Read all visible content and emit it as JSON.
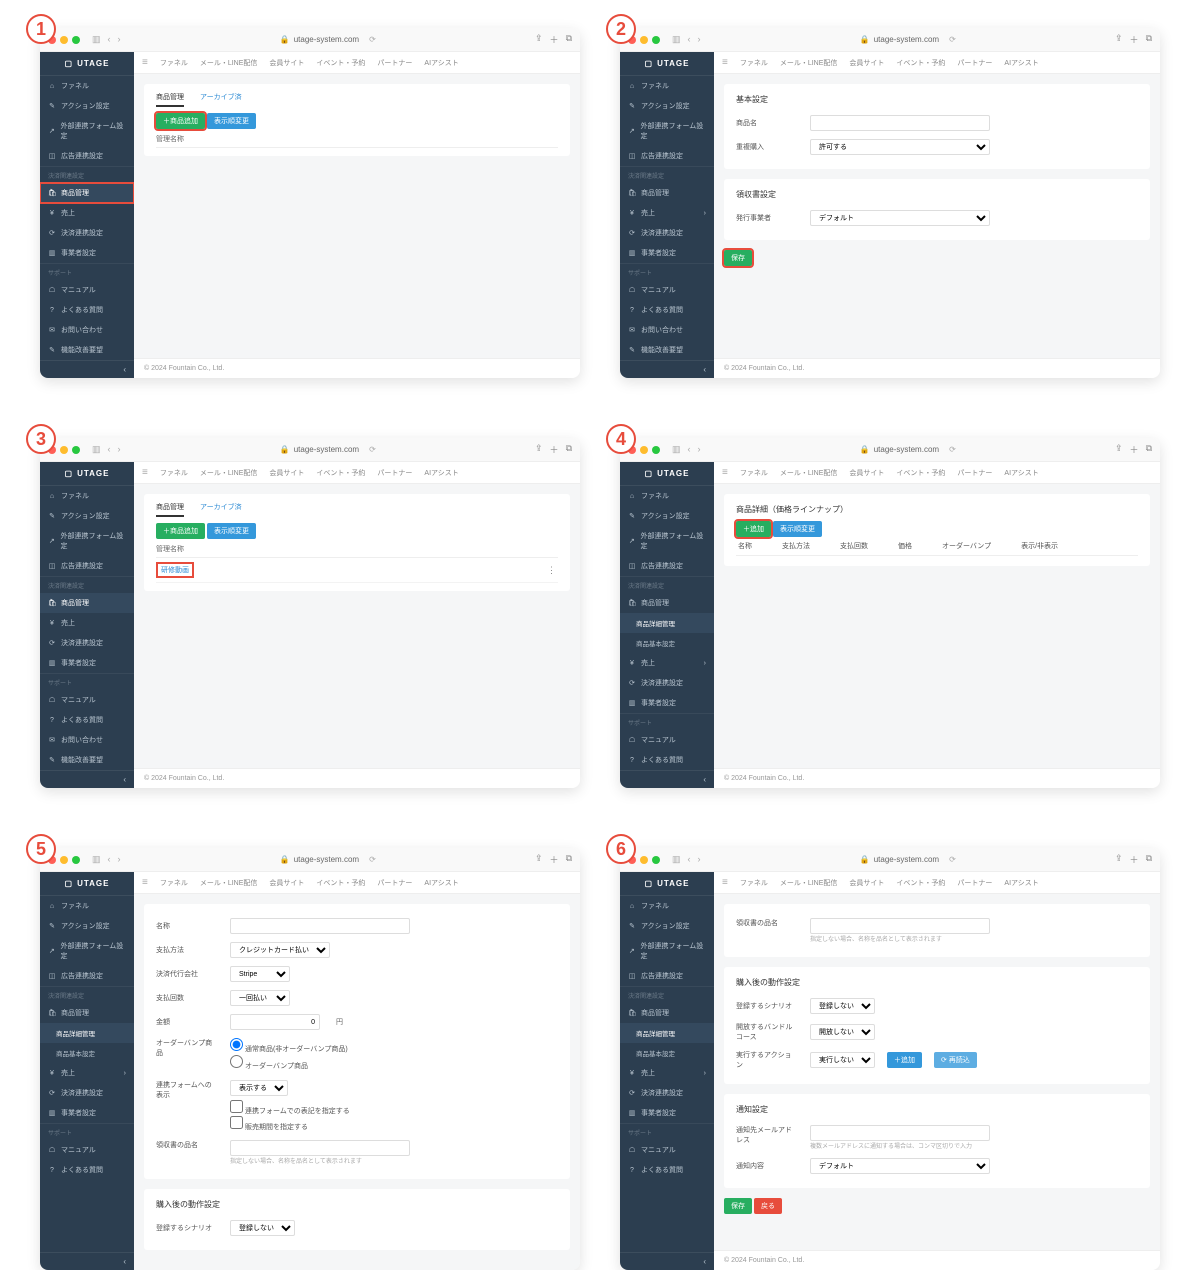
{
  "url": "utage-system.com",
  "footer": "© 2024 Fountain Co., Ltd.",
  "logo": "UTAGE",
  "topnav": [
    "ファネル",
    "メール・LINE配信",
    "会員サイト",
    "イベント・予約",
    "パートナー",
    "AIアシスト"
  ],
  "sidebar": {
    "items": [
      {
        "ico": "⌂",
        "label": "ファネル"
      },
      {
        "ico": "✎",
        "label": "アクション設定"
      },
      {
        "ico": "↗",
        "label": "外部連携フォーム設定"
      },
      {
        "ico": "◫",
        "label": "広告連携設定"
      }
    ],
    "sec_pay": "決済関連設定",
    "pay": [
      {
        "ico": "🛍",
        "label": "商品管理"
      },
      {
        "ico": "¥",
        "label": "売上"
      },
      {
        "ico": "⟳",
        "label": "決済連携設定"
      },
      {
        "ico": "▥",
        "label": "事業者設定"
      }
    ],
    "paysub": [
      {
        "label": "商品詳細管理"
      },
      {
        "label": "商品基本設定"
      }
    ],
    "sec_support": "サポート",
    "support": [
      {
        "ico": "☖",
        "label": "マニュアル"
      },
      {
        "ico": "?",
        "label": "よくある質問"
      },
      {
        "ico": "✉",
        "label": "お問い合わせ"
      },
      {
        "ico": "✎",
        "label": "機能改善要望"
      }
    ]
  },
  "s1": {
    "tabs": [
      "商品管理",
      "アーカイブ済"
    ],
    "btn_add": "＋商品追加",
    "btn_disp": "表示順変更",
    "th": "管理名称"
  },
  "s2": {
    "sect_basic": "基本設定",
    "lbl_name": "商品名",
    "lbl_rebuy": "重複購入",
    "opt_rebuy": "許可する",
    "sect_receipt": "領収書設定",
    "lbl_issuer": "発行事業者",
    "opt_issuer": "デフォルト",
    "btn_save": "保存"
  },
  "s3": {
    "item": "研修動画"
  },
  "s4": {
    "title": "商品詳細（価格ラインナップ）",
    "btn_add": "＋追加",
    "btn_disp": "表示順変更",
    "cols": [
      "名称",
      "支払方法",
      "支払回数",
      "価格",
      "オーダーバンプ",
      "表示/非表示"
    ]
  },
  "s5": {
    "lbl_name": "名称",
    "lbl_pay": "支払方法",
    "opt_pay": "クレジットカード払い",
    "lbl_agent": "決済代行会社",
    "opt_agent": "Stripe",
    "lbl_times": "支払回数",
    "opt_times": "一回払い",
    "lbl_amount": "金額",
    "unit": "円",
    "lbl_bump": "オーダーバンプ商品",
    "radio1": "通常商品(非オーダーバンプ商品)",
    "radio2": "オーダーバンプ商品",
    "lbl_form": "連携フォームへの表示",
    "opt_form": "表示する",
    "chk1": "連携フォームでの表記を指定する",
    "chk2": "販売期間を指定する",
    "lbl_rec": "領収書の品名",
    "hint_rec": "指定しない場合、名称を品名として表示されます",
    "sect_post": "購入後の動作設定",
    "lbl_scen": "登録するシナリオ",
    "opt_scen": "登録しない"
  },
  "s6": {
    "lbl_rec": "領収書の品名",
    "hint_rec": "指定しない場合、名称を品名として表示されます",
    "sect_post": "購入後の動作設定",
    "lbl_scen": "登録するシナリオ",
    "opt_scen": "登録しない",
    "lbl_bundle": "開放するバンドルコース",
    "opt_bundle": "開放しない",
    "lbl_action": "実行するアクション",
    "opt_action": "実行しない",
    "btn_add_act": "＋追加",
    "btn_tpl": "⟳ 再読込",
    "sect_notify": "通知設定",
    "lbl_email": "通知先メールアドレス",
    "hint_email": "複数メールアドレスに通知する場合は、コンマ区切りで入力",
    "lbl_content": "通知内容",
    "opt_content": "デフォルト",
    "btn_save": "保存",
    "btn_back": "戻る"
  }
}
